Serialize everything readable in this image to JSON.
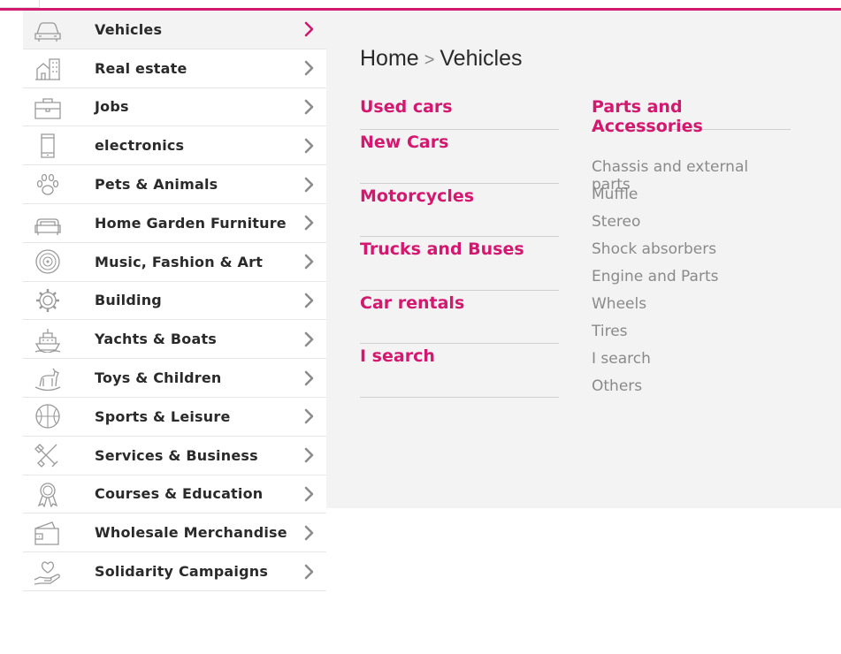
{
  "breadcrumb": {
    "home": "Home",
    "separator": ">",
    "current": "Vehicles"
  },
  "categories": [
    {
      "label": "Vehicles",
      "icon": "car-icon",
      "active": true
    },
    {
      "label": "Real estate",
      "icon": "building-house-icon",
      "active": false
    },
    {
      "label": "Jobs",
      "icon": "briefcase-icon",
      "active": false
    },
    {
      "label": "electronics",
      "icon": "phone-icon",
      "active": false
    },
    {
      "label": "Pets & Animals",
      "icon": "paw-icon",
      "active": false
    },
    {
      "label": "Home Garden Furniture",
      "icon": "sofa-icon",
      "active": false
    },
    {
      "label": "Music, Fashion & Art",
      "icon": "vinyl-icon",
      "active": false
    },
    {
      "label": "Building",
      "icon": "gear-icon",
      "active": false
    },
    {
      "label": "Yachts & Boats",
      "icon": "ship-icon",
      "active": false
    },
    {
      "label": "Toys & Children",
      "icon": "rocking-horse-icon",
      "active": false
    },
    {
      "label": "Sports & Leisure",
      "icon": "ball-icon",
      "active": false
    },
    {
      "label": "Services & Business",
      "icon": "tools-icon",
      "active": false
    },
    {
      "label": "Courses & Education",
      "icon": "award-icon",
      "active": false
    },
    {
      "label": "Wholesale Merchandise",
      "icon": "wallet-icon",
      "active": false
    },
    {
      "label": "Solidarity Campaigns",
      "icon": "heart-hand-icon",
      "active": false
    }
  ],
  "subcategories": [
    "Used cars",
    "New Cars",
    "Motorcycles",
    "Trucks and Buses",
    "Car rentals",
    "I search"
  ],
  "parts": {
    "title": "Parts and Accessories",
    "items": [
      "Chassis and external parts",
      "Muffle",
      "Stereo",
      "Shock absorbers",
      "Engine and Parts",
      "Wheels",
      "Tires",
      "I search",
      "Others"
    ]
  },
  "colors": {
    "accent": "#d4176f",
    "text": "#2a2a2a",
    "muted": "#8a8a8a",
    "panel": "#f3f3f3"
  }
}
